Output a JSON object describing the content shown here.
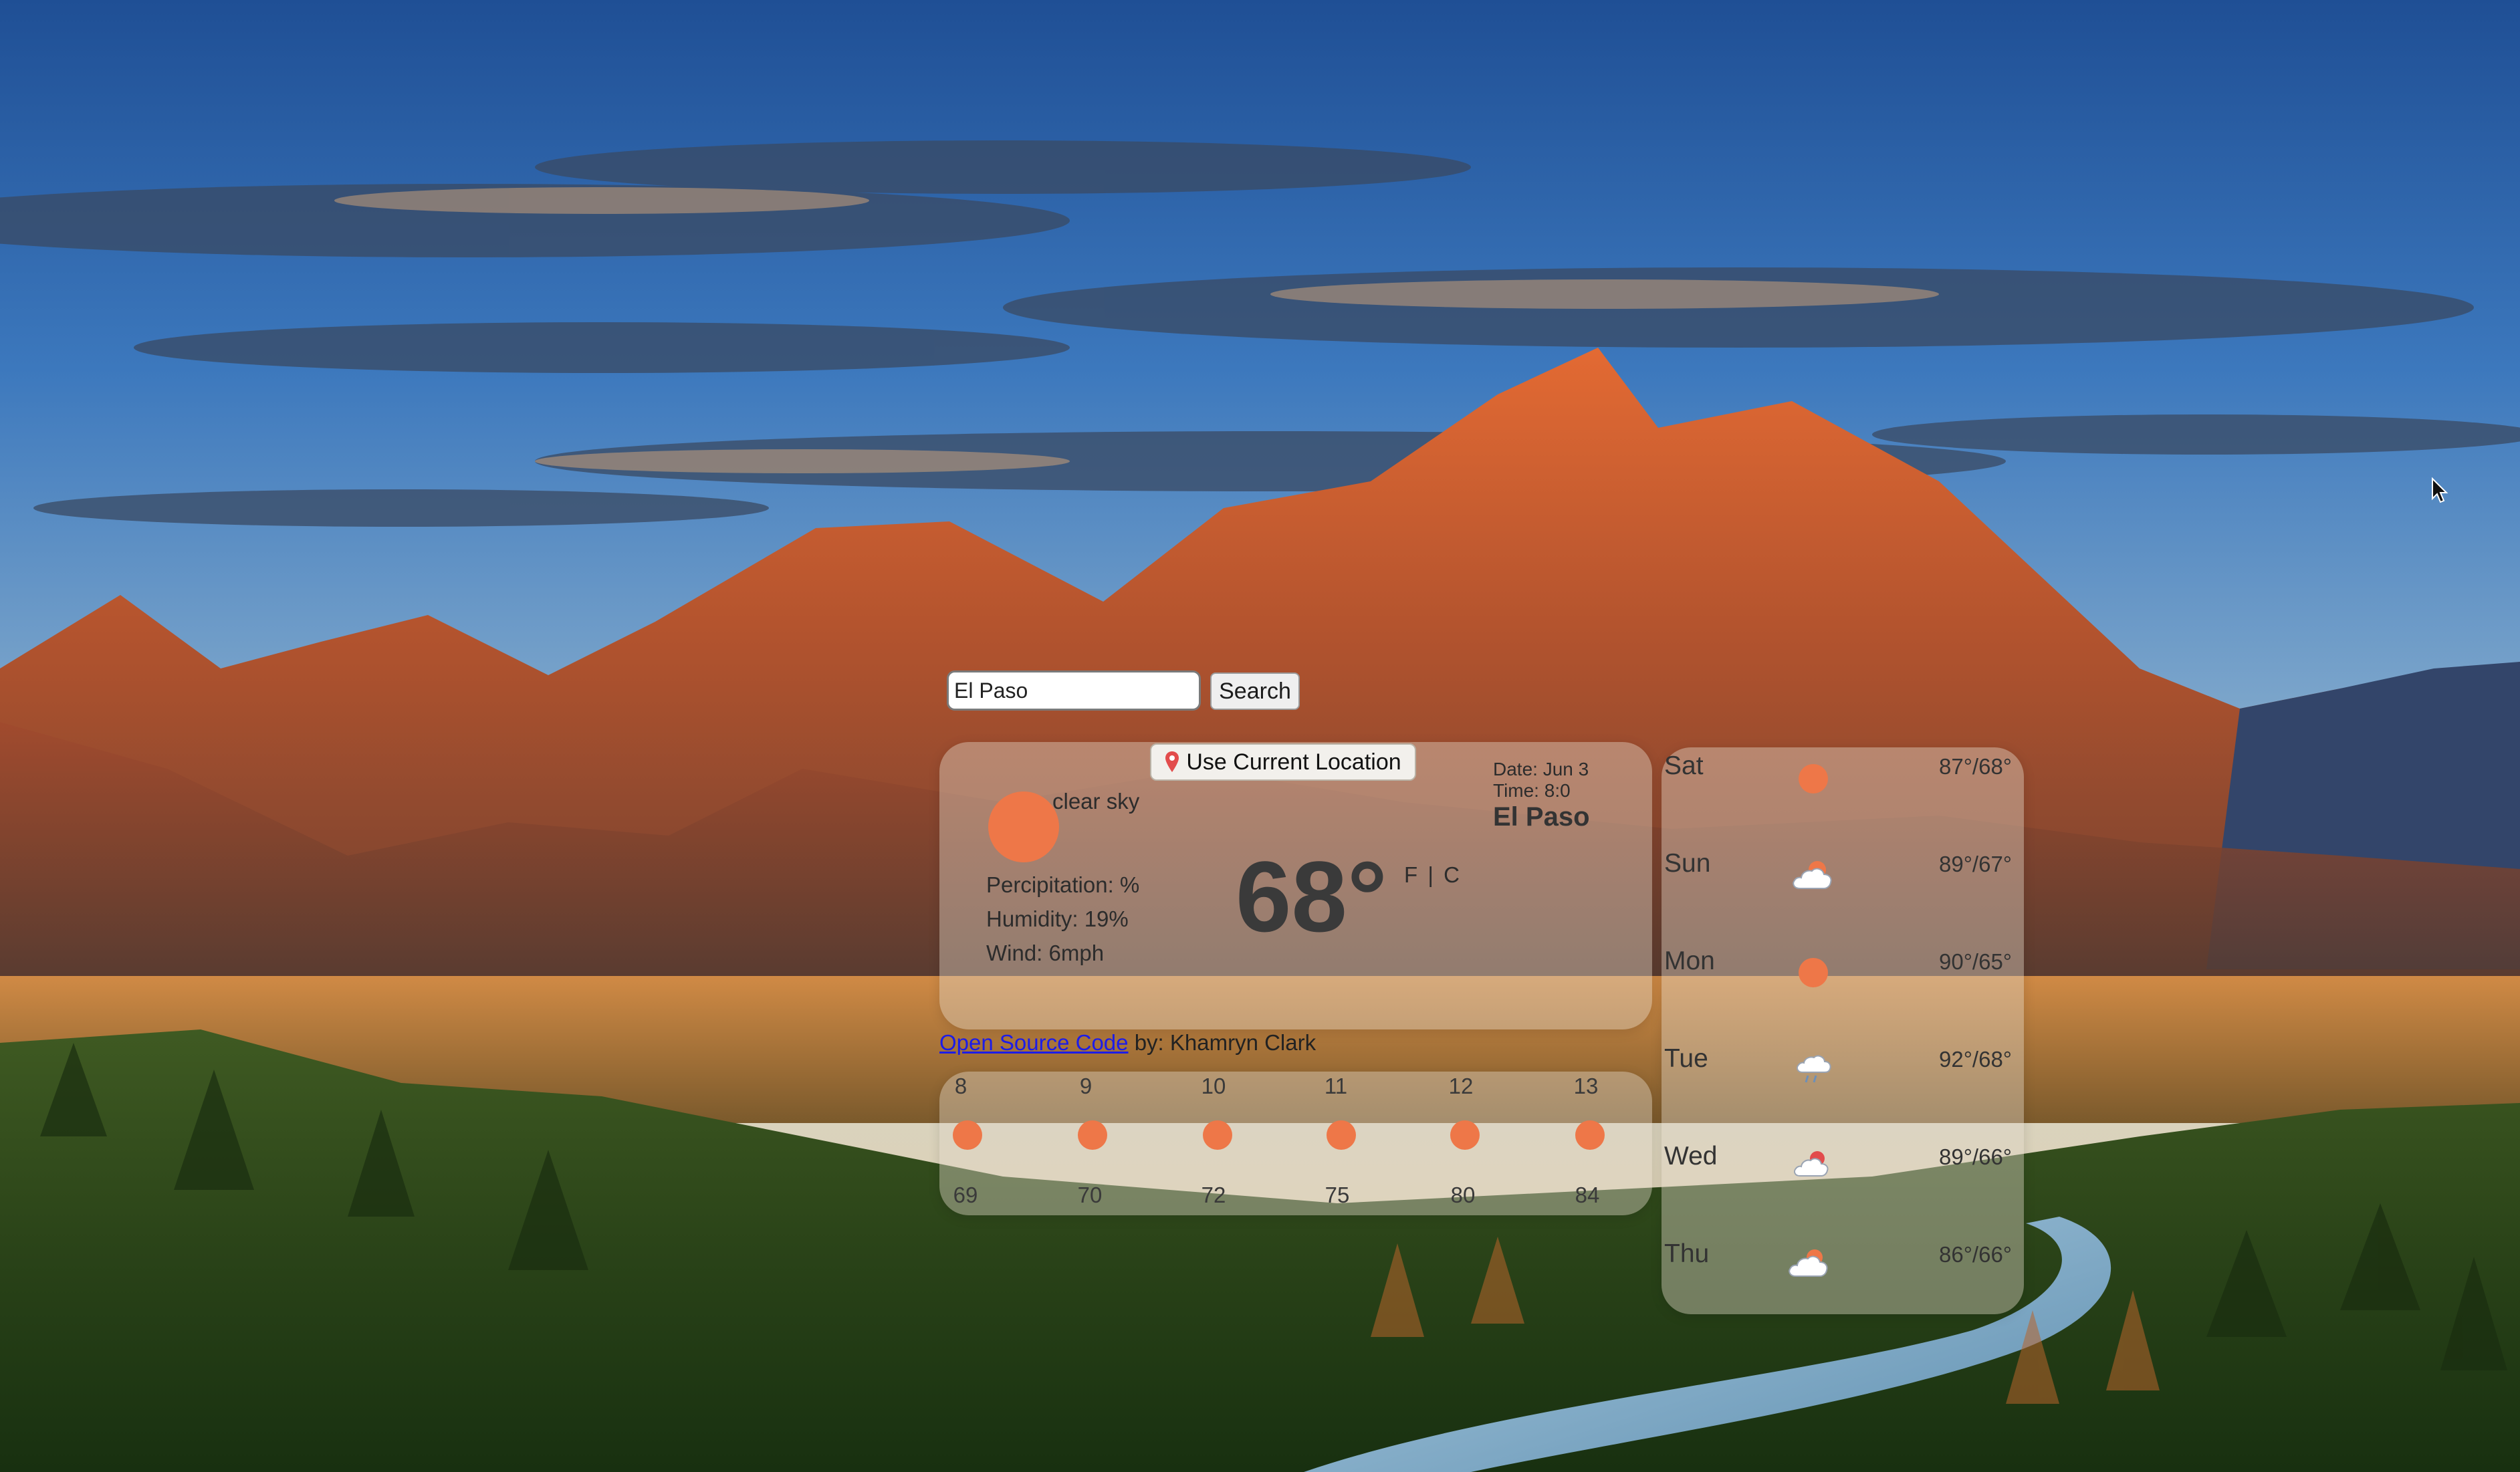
{
  "search": {
    "value": "El Paso",
    "button_label": "Search"
  },
  "location_button": {
    "label": "Use Current Location"
  },
  "current": {
    "condition": "clear sky",
    "precipitation": "Percipitation: %",
    "humidity": "Humidity: 19%",
    "wind": "Wind: 6mph",
    "temperature": "68°",
    "units": "F | C",
    "date": "Date: Jun 3",
    "time": "Time: 8:0",
    "city": "El Paso",
    "icon": "sun-icon"
  },
  "footer": {
    "link_label": "Open Source Code",
    "author": "by: Khamryn Clark"
  },
  "hourly": [
    {
      "hour": "8",
      "temp": "69",
      "icon": "sun-icon"
    },
    {
      "hour": "9",
      "temp": "70",
      "icon": "sun-icon"
    },
    {
      "hour": "10",
      "temp": "72",
      "icon": "sun-icon"
    },
    {
      "hour": "11",
      "temp": "75",
      "icon": "sun-icon"
    },
    {
      "hour": "12",
      "temp": "80",
      "icon": "sun-icon"
    },
    {
      "hour": "13",
      "temp": "84",
      "icon": "sun-icon"
    }
  ],
  "daily": [
    {
      "day": "Sat",
      "temps": "87°/68°",
      "icon": "sun-icon"
    },
    {
      "day": "Sun",
      "temps": "89°/67°",
      "icon": "partly-cloudy-icon"
    },
    {
      "day": "Mon",
      "temps": "90°/65°",
      "icon": "sun-icon"
    },
    {
      "day": "Tue",
      "temps": "92°/68°",
      "icon": "rain-cloud-icon"
    },
    {
      "day": "Wed",
      "temps": "89°/66°",
      "icon": "partly-cloudy-icon"
    },
    {
      "day": "Thu",
      "temps": "86°/66°",
      "icon": "partly-cloudy-icon"
    }
  ],
  "colors": {
    "accent_sun": "#ee7748",
    "panel": "rgba(225,215,200,0.42)",
    "link": "#1c1ce8"
  }
}
